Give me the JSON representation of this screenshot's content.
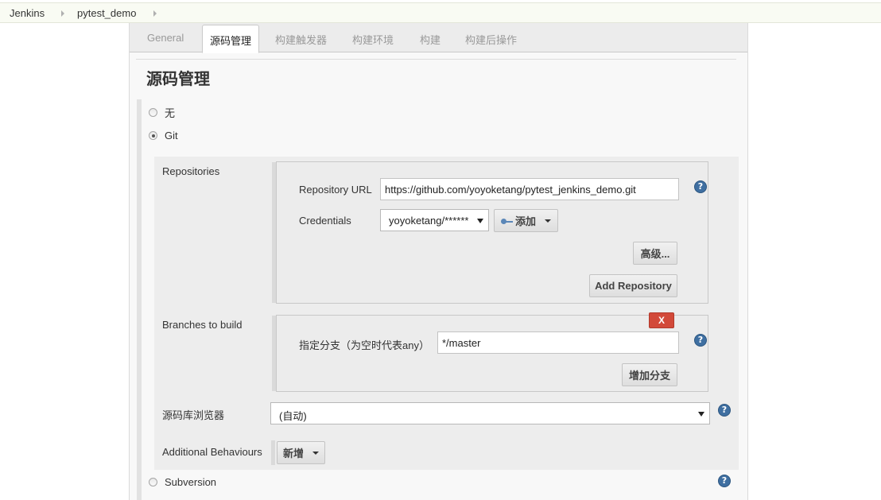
{
  "breadcrumb": {
    "items": [
      "Jenkins",
      "pytest_demo"
    ]
  },
  "tabs": [
    {
      "label": "General",
      "active": false
    },
    {
      "label": "源码管理",
      "active": true
    },
    {
      "label": "构建触发器",
      "active": false
    },
    {
      "label": "构建环境",
      "active": false
    },
    {
      "label": "构建",
      "active": false
    },
    {
      "label": "构建后操作",
      "active": false
    }
  ],
  "section": {
    "title": "源码管理"
  },
  "scm_options": {
    "none_label": "无",
    "git_label": "Git",
    "subversion_label": "Subversion",
    "selected": "Git"
  },
  "repositories": {
    "label": "Repositories",
    "url_label": "Repository URL",
    "url_value": "https://github.com/yoyoketang/pytest_jenkins_demo.git",
    "credentials_label": "Credentials",
    "credentials_value": "yoyoketang/******",
    "add_label": "添加",
    "advanced_label": "高级...",
    "add_repository_label": "Add Repository"
  },
  "branches": {
    "label": "Branches to build",
    "delete_label": "X",
    "specifier_label": "指定分支（为空时代表any）",
    "specifier_value": "*/master",
    "add_branch_label": "增加分支"
  },
  "browser": {
    "label": "源码库浏览器",
    "value": "(自动)"
  },
  "behaviours": {
    "label": "Additional Behaviours",
    "add_label": "新增"
  },
  "help_icon_glyph": "?",
  "colors": {
    "help_blue": "#3f6fa1",
    "delete_red": "#d24939",
    "breadcrumb_bg": "#f9fbf3"
  }
}
